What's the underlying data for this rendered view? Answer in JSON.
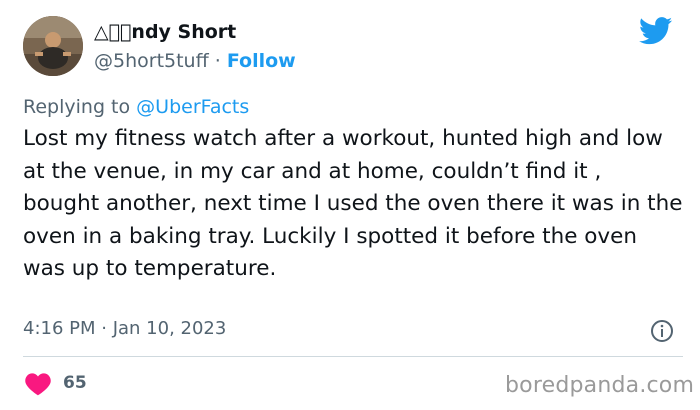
{
  "user": {
    "display_name": "△⃞⃞ndy Short",
    "handle": "@5hort5tuff",
    "separator": "·",
    "follow_label": "Follow"
  },
  "reply": {
    "prefix": "Replying to",
    "mention": "@UberFacts"
  },
  "tweet": {
    "text": "Lost my fitness watch after a workout, hunted high and low at the venue, in my car and at home, couldn’t find it , bought another, next time I used the oven there it was in the oven in a baking tray. Luckily I spotted it before the oven was up to temperature.",
    "timestamp": "4:16 PM · Jan 10, 2023"
  },
  "engagement": {
    "likes": "65"
  },
  "watermark": "boredpanda.com",
  "colors": {
    "twitter_blue": "#1d9bf0",
    "heart_red": "#f91880",
    "muted_text": "#536471"
  },
  "icons": {
    "logo": "twitter-bird-icon",
    "info": "info-icon",
    "like": "heart-icon"
  }
}
